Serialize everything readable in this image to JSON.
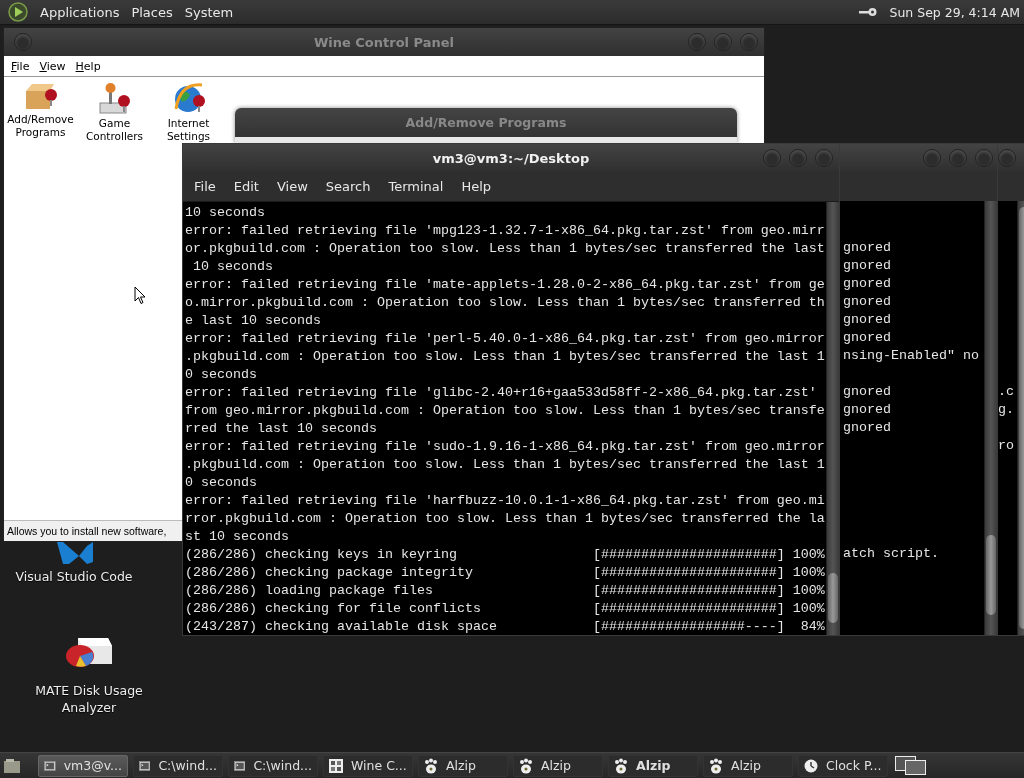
{
  "top_panel": {
    "menus": [
      "Applications",
      "Places",
      "System"
    ],
    "clock": "Sun Sep 29, 4:14 AM"
  },
  "desktop_icons": [
    {
      "label": "Visual Studio Code",
      "kind": "vscode"
    },
    {
      "label": "MATE Disk Usage Analyzer",
      "kind": "disk"
    }
  ],
  "wine_control_panel": {
    "title": "Wine Control Panel",
    "menu": [
      "File",
      "View",
      "Help"
    ],
    "applets": [
      {
        "label": "Add/Remove Programs",
        "kind": "box"
      },
      {
        "label": "Game Controllers",
        "kind": "joystick"
      },
      {
        "label": "Internet Settings",
        "kind": "globe"
      }
    ],
    "status": "Allows you to install new software,"
  },
  "add_remove_dialog": {
    "title": "Add/Remove Programs"
  },
  "background_terminals": [
    {
      "blocks": [
        [
          "gnored",
          "gnored",
          "gnored",
          "gnored",
          "gnored",
          "gnored",
          "nsing-Enabled\" no"
        ],
        [
          "gnored",
          "gnored",
          "gnored"
        ],
        [
          "atch script."
        ]
      ]
    },
    {
      "blocks": [
        [
          ".c",
          "g."
        ],
        [
          "ro"
        ]
      ]
    }
  ],
  "terminal": {
    "title": "vm3@vm3:~/Desktop",
    "menu": [
      "File",
      "Edit",
      "View",
      "Search",
      "Terminal",
      "Help"
    ],
    "lines": [
      "10 seconds",
      "error: failed retrieving file 'mpg123-1.32.7-1-x86_64.pkg.tar.zst' from geo.mirr",
      "or.pkgbuild.com : Operation too slow. Less than 1 bytes/sec transferred the last",
      " 10 seconds",
      "error: failed retrieving file 'mate-applets-1.28.0-2-x86_64.pkg.tar.zst' from ge",
      "o.mirror.pkgbuild.com : Operation too slow. Less than 1 bytes/sec transferred th",
      "e last 10 seconds",
      "error: failed retrieving file 'perl-5.40.0-1-x86_64.pkg.tar.zst' from geo.mirror",
      ".pkgbuild.com : Operation too slow. Less than 1 bytes/sec transferred the last 1",
      "0 seconds",
      "error: failed retrieving file 'glibc-2.40+r16+gaa533d58ff-2-x86_64.pkg.tar.zst'",
      "from geo.mirror.pkgbuild.com : Operation too slow. Less than 1 bytes/sec transfe",
      "rred the last 10 seconds",
      "error: failed retrieving file 'sudo-1.9.16-1-x86_64.pkg.tar.zst' from geo.mirror",
      ".pkgbuild.com : Operation too slow. Less than 1 bytes/sec transferred the last 1",
      "0 seconds",
      "error: failed retrieving file 'harfbuzz-10.0.1-1-x86_64.pkg.tar.zst' from geo.mi",
      "rror.pkgbuild.com : Operation too slow. Less than 1 bytes/sec transferred the la",
      "st 10 seconds",
      "(286/286) checking keys in keyring                 [######################] 100%",
      "(286/286) checking package integrity               [######################] 100%",
      "(286/286) loading package files                    [######################] 100%",
      "(286/286) checking for file conflicts              [######################] 100%",
      "(243/287) checking available disk space            [##################----]  84%"
    ]
  },
  "taskbar": {
    "items": [
      {
        "label": "vm3@v...",
        "kind": "terminal",
        "selected": true,
        "bold": false
      },
      {
        "label": "C:\\wind...",
        "kind": "terminal",
        "selected": false,
        "bold": false
      },
      {
        "label": "C:\\wind...",
        "kind": "terminal",
        "selected": false,
        "bold": false
      },
      {
        "label": "Wine C...",
        "kind": "wine",
        "selected": false,
        "bold": false
      },
      {
        "label": "Alzip",
        "kind": "alzip",
        "selected": false,
        "bold": false
      },
      {
        "label": "Alzip",
        "kind": "alzip",
        "selected": false,
        "bold": false
      },
      {
        "label": "Alzip",
        "kind": "alzip",
        "selected": false,
        "bold": true
      },
      {
        "label": "Alzip",
        "kind": "alzip",
        "selected": false,
        "bold": false
      },
      {
        "label": "Clock P...",
        "kind": "clock",
        "selected": false,
        "bold": false
      }
    ]
  }
}
